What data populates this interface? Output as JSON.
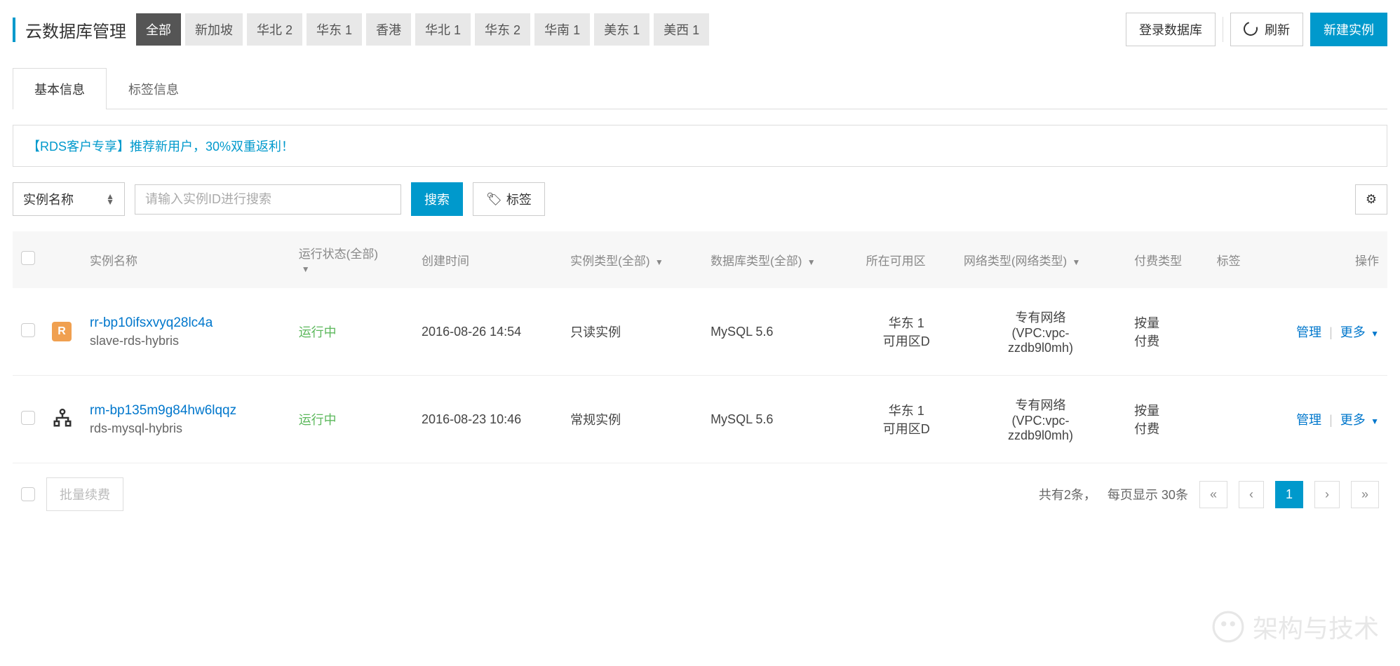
{
  "page_title": "云数据库管理",
  "regions": [
    {
      "label": "全部",
      "active": true
    },
    {
      "label": "新加坡",
      "active": false
    },
    {
      "label": "华北 2",
      "active": false
    },
    {
      "label": "华东 1",
      "active": false
    },
    {
      "label": "香港",
      "active": false
    },
    {
      "label": "华北 1",
      "active": false
    },
    {
      "label": "华东 2",
      "active": false
    },
    {
      "label": "华南 1",
      "active": false
    },
    {
      "label": "美东 1",
      "active": false
    },
    {
      "label": "美西 1",
      "active": false
    }
  ],
  "actions": {
    "login_db": "登录数据库",
    "refresh": "刷新",
    "create": "新建实例"
  },
  "tabs": [
    {
      "label": "基本信息",
      "active": true
    },
    {
      "label": "标签信息",
      "active": false
    }
  ],
  "banner": "【RDS客户专享】推荐新用户，30%双重返利！",
  "search": {
    "field_label": "实例名称",
    "placeholder": "请输入实例ID进行搜索",
    "button": "搜索",
    "tag_button": "标签"
  },
  "columns": {
    "name": "实例名称",
    "status": "运行状态(全部)",
    "created": "创建时间",
    "type": "实例类型(全部)",
    "dbtype": "数据库类型(全部)",
    "zone": "所在可用区",
    "nettype": "网络类型(网络类型)",
    "billing": "付费类型",
    "tag": "标签",
    "ops": "操作"
  },
  "rows": [
    {
      "icon": "R",
      "id": "rr-bp10ifsxvyq28lc4a",
      "alias": "slave-rds-hybris",
      "status": "运行中",
      "created": "2016-08-26 14:54",
      "type": "只读实例",
      "dbtype": "MySQL 5.6",
      "zone_line1": "华东 1",
      "zone_line2": "可用区D",
      "net_line1": "专有网络",
      "net_line2": "(VPC:vpc-",
      "net_line3": "zzdb9l0mh)",
      "billing": "按量付费",
      "manage": "管理",
      "more": "更多"
    },
    {
      "icon": "net",
      "id": "rm-bp135m9g84hw6lqqz",
      "alias": "rds-mysql-hybris",
      "status": "运行中",
      "created": "2016-08-23 10:46",
      "type": "常规实例",
      "dbtype": "MySQL 5.6",
      "zone_line1": "华东 1",
      "zone_line2": "可用区D",
      "net_line1": "专有网络",
      "net_line2": "(VPC:vpc-",
      "net_line3": "zzdb9l0mh)",
      "billing": "按量付费",
      "manage": "管理",
      "more": "更多"
    }
  ],
  "footer": {
    "batch_renew": "批量续费",
    "total": "共有2条，",
    "per_page": "每页显示  30条",
    "page": "1",
    "watermark": "架构与技术"
  }
}
